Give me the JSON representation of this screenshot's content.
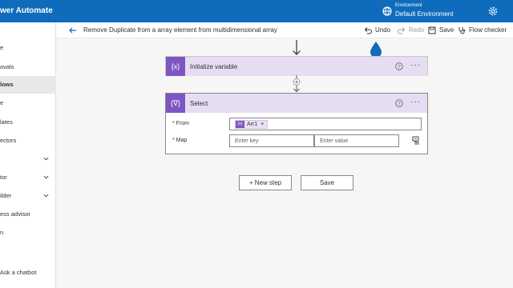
{
  "header": {
    "app_title": "wer Automate",
    "environment_label": "Environment",
    "environment_name": "Default Environment"
  },
  "sidebar": {
    "items": [
      {
        "label": "e"
      },
      {
        "label": "ovals"
      },
      {
        "label": "lows"
      },
      {
        "label": "e"
      },
      {
        "label": "lates"
      },
      {
        "label": "ectors"
      },
      {
        "label": ""
      },
      {
        "label": "tor"
      },
      {
        "label": "ilder"
      },
      {
        "label": "ess advisor"
      },
      {
        "label": "n"
      },
      {
        "label": "Ask a chatbot"
      }
    ]
  },
  "command_bar": {
    "flow_title": "Remove Duplicate from a array element from multidimensional array",
    "undo": "Undo",
    "redo": "Redo",
    "save": "Save",
    "flow_checker": "Flow checker"
  },
  "steps": {
    "initialize": {
      "icon_text": "{x}",
      "title": "Initialize variable"
    },
    "select": {
      "icon_text": "{∇}",
      "title": "Select",
      "from_label": "* From",
      "from_token": "Arr1",
      "token_icon": "{x}",
      "token_remove": "×",
      "map_label": "* Map",
      "key_placeholder": "Enter key",
      "value_placeholder": "Enter value"
    }
  },
  "canvas": {
    "new_step_label": "+ New step",
    "save_label": "Save"
  },
  "colors": {
    "header_blue": "#0f6cbd",
    "variable_purple": "#7e56c2",
    "variable_header": "#e6ddf2"
  }
}
